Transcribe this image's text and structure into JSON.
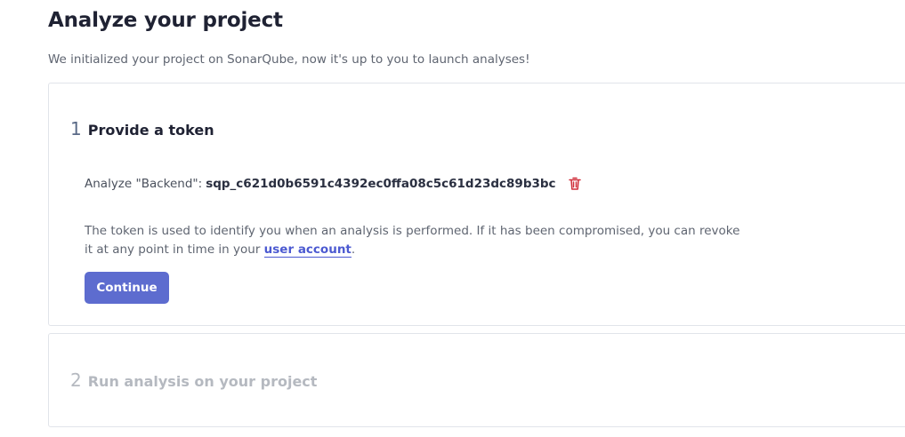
{
  "page": {
    "title": "Analyze your project",
    "subtitle": "We initialized your project on SonarQube, now it's up to you to launch analyses!"
  },
  "step1": {
    "number": "1",
    "title": "Provide a token",
    "token_label": "Analyze \"Backend\":",
    "token_value": "sqp_c621d0b6591c4392ec0ffa08c5c61d23dc89b3bc",
    "delete_icon": "trash-icon",
    "info_text_before": "The token is used to identify you when an analysis is performed. If it has been compromised, you can revoke it at any point in time in your ",
    "info_link": "user account",
    "info_text_after": ".",
    "continue_label": "Continue"
  },
  "step2": {
    "number": "2",
    "title": "Run analysis on your project"
  },
  "colors": {
    "primary_button": "#5d6ccf",
    "link": "#4c5ad1",
    "delete_icon": "#d02f3a",
    "disabled_text": "#b5b9c0"
  }
}
